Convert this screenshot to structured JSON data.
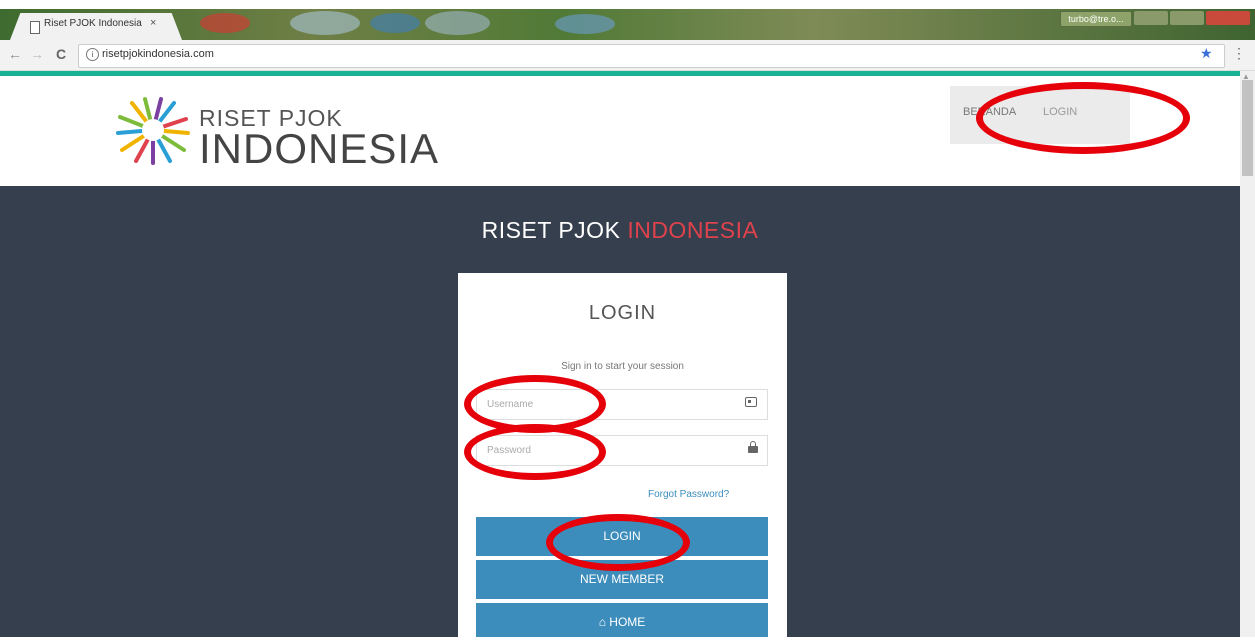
{
  "browser": {
    "tab_title": "Riset PJOK Indonesia",
    "tab_close": "×",
    "url": "risetpjokindonesia.com",
    "user_chip": "turbo@tre.o...",
    "back": "←",
    "forward": "→",
    "reload": "C",
    "info": "i",
    "star": "★",
    "menu": "⋮"
  },
  "site": {
    "logo_line1": "RISET PJOK",
    "logo_line2": "INDONESIA",
    "nav": {
      "beranda": "BERANDA",
      "login": "LOGIN"
    }
  },
  "login": {
    "brand_part1": "RISET PJOK",
    "brand_part2": "INDONESIA",
    "title": "LOGIN",
    "subtitle": "Sign in to start your session",
    "username_placeholder": "Username",
    "password_placeholder": "Password",
    "forgot": "Forgot Password?",
    "btn_login": "LOGIN",
    "btn_new_member": "NEW MEMBER",
    "btn_home": "HOME",
    "home_icon": "home-icon"
  },
  "colors": {
    "accent_green": "#19b394",
    "panel_bg": "#353f4d",
    "brand_red": "#e0424d",
    "button_blue": "#3c8dbc",
    "annotation_red": "#e5000a"
  }
}
